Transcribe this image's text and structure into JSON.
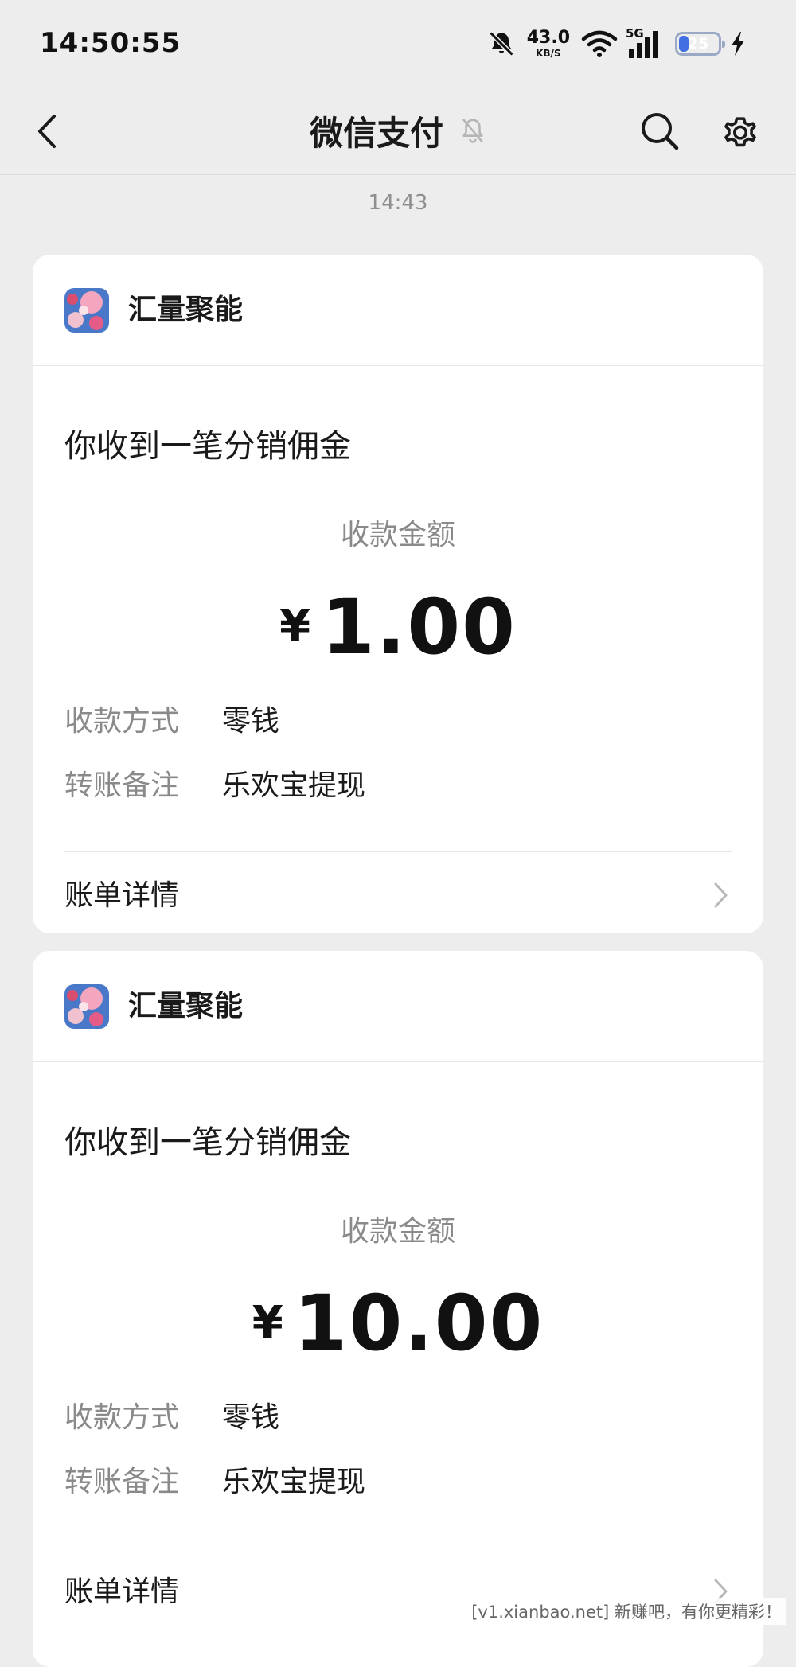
{
  "status_bar": {
    "time": "14:50:55",
    "net_speed_value": "43.0",
    "net_speed_unit": "KB/S",
    "network_type": "5G",
    "battery_level": "25",
    "battery_fraction": 0.25
  },
  "nav": {
    "title": "微信支付"
  },
  "message_time": "14:43",
  "cards": [
    {
      "merchant_name": "汇量聚能",
      "title": "你收到一笔分销佣金",
      "amount_label": "收款金额",
      "currency_symbol": "¥",
      "amount": "1.00",
      "method_label": "收款方式",
      "method_value": "零钱",
      "note_label": "转账备注",
      "note_value": "乐欢宝提现",
      "footer_label": "账单详情"
    },
    {
      "merchant_name": "汇量聚能",
      "title": "你收到一笔分销佣金",
      "amount_label": "收款金额",
      "currency_symbol": "¥",
      "amount": "10.00",
      "method_label": "收款方式",
      "method_value": "零钱",
      "note_label": "转账备注",
      "note_value": "乐欢宝提现",
      "footer_label": "账单详情"
    }
  ],
  "watermark": "[v1.xianbao.net] 新赚吧，有你更精彩！",
  "colors": {
    "background": "#ededed",
    "card": "#ffffff",
    "text_primary": "#1a1a1a",
    "text_secondary": "#8a8a8a",
    "battery_accent": "#3f6fe0"
  },
  "icons": [
    "back-arrow-icon",
    "mute-bell-icon",
    "search-icon",
    "gear-icon",
    "chevron-right-icon",
    "wifi-icon",
    "signal-icon",
    "charging-bolt-icon",
    "do-not-disturb-icon"
  ]
}
